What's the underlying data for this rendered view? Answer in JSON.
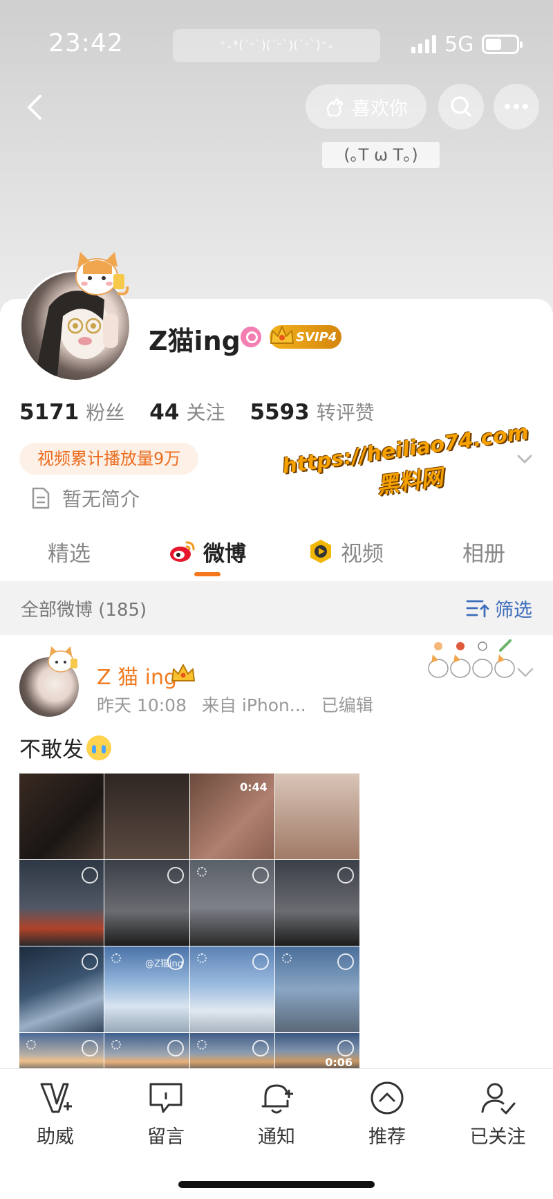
{
  "status_bar": {
    "time": "23:42",
    "kaomoji_banner": "⁺₊*(ˊᵕˋ)(ˊᵕˋ)(ˊᵕˋ)⁺₊",
    "network": "5G"
  },
  "header": {
    "like_label": "喜欢你",
    "mood": "(｡T ω T｡)"
  },
  "profile": {
    "username": "Z猫ing",
    "svip_label": "SVIP4",
    "stats": [
      {
        "value": "5171",
        "label": "粉丝"
      },
      {
        "value": "44",
        "label": "关注"
      },
      {
        "value": "5593",
        "label": "转评赞"
      }
    ],
    "video_plays": "视频累计播放量9万",
    "bio": "暂无简介"
  },
  "watermark": {
    "url": "https://heiliao74.com",
    "name": "黑料网"
  },
  "tabs": [
    {
      "label": "精选",
      "active": false
    },
    {
      "label": "微博",
      "active": true
    },
    {
      "label": "视频",
      "active": false
    },
    {
      "label": "相册",
      "active": false
    }
  ],
  "filter": {
    "count_label": "全部微博 (185)",
    "button_label": "筛选"
  },
  "post": {
    "author": "Z 猫 ing",
    "time": "昨天 10:08",
    "source": "来自 iPhon...",
    "edited": "已编辑",
    "text": "不敢发",
    "grid_watermark": "@Z猫ing",
    "durations": [
      "0:44",
      "0:06"
    ]
  },
  "bottom_nav": [
    {
      "label": "助威",
      "icon": "v-plus-icon"
    },
    {
      "label": "留言",
      "icon": "message-icon"
    },
    {
      "label": "通知",
      "icon": "bell-plus-icon"
    },
    {
      "label": "推荐",
      "icon": "up-arrow-circle-icon"
    },
    {
      "label": "已关注",
      "icon": "user-check-icon"
    }
  ],
  "colors": {
    "accent_orange": "#f5761b",
    "link_blue": "#3c6cba",
    "video_pill_bg": "#fdf0e6",
    "video_pill_text": "#ea6d1f"
  }
}
